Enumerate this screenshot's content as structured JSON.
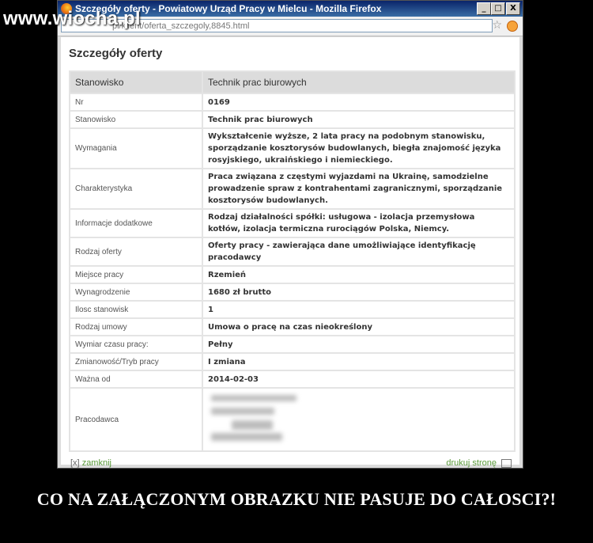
{
  "watermark": "www.wiocha.pl",
  "window": {
    "title": "Szczegóły oferty - Powiatowy Urząd Pracy w Mielcu - Mozilla Firefox",
    "url": "pl/klient/oferta_szczegoly,8845.html",
    "minimize": "_",
    "maximize": "□",
    "close": "X"
  },
  "page": {
    "heading": "Szczegóły oferty",
    "header_row": {
      "label": "Stanowisko",
      "value": "Technik prac biurowych"
    },
    "rows": [
      {
        "label": "Nr",
        "value": "0169"
      },
      {
        "label": "Stanowisko",
        "value": "Technik prac biurowych"
      },
      {
        "label": "Wymagania",
        "value": "Wykształcenie wyższe, 2 lata pracy na podobnym stanowisku, sporządzanie kosztorysów budowlanych, biegła znajomość języka rosyjskiego, ukraińskiego i niemieckiego."
      },
      {
        "label": "Charakterystyka",
        "value": "Praca związana z częstymi wyjazdami na Ukrainę, samodzielne prowadzenie spraw z kontrahentami zagranicznymi, sporządzanie kosztorysów budowlanych."
      },
      {
        "label": "Informacje dodatkowe",
        "value": "Rodzaj działalności spółki: usługowa - izolacja przemysłowa kotłów, izolacja termiczna rurociągów Polska, Niemcy."
      },
      {
        "label": "Rodzaj oferty",
        "value": "Oferty pracy - zawierająca dane umożliwiające identyfikację pracodawcy"
      },
      {
        "label": "Miejsce pracy",
        "value": "Rzemień"
      },
      {
        "label": "Wynagrodzenie",
        "value": "1680 zł brutto"
      },
      {
        "label": "Ilosc stanowisk",
        "value": "1"
      },
      {
        "label": "Rodzaj umowy",
        "value": "Umowa o pracę na czas nieokreślony"
      },
      {
        "label": "Wymiar czasu pracy:",
        "value": "Pełny"
      },
      {
        "label": "Zmianowość/Tryb pracy",
        "value": "I zmiana"
      },
      {
        "label": "Ważna od",
        "value": "2014-02-03"
      },
      {
        "label": "Pracodawca",
        "value": ""
      }
    ],
    "footer": {
      "close_prefix": "[x]",
      "close_label": "zamknij",
      "print_label": "drukuj stronę"
    }
  },
  "caption": "CO NA ZAŁĄCZONYM OBRAZKU NIE PASUJE DO CAŁOSCI?!"
}
